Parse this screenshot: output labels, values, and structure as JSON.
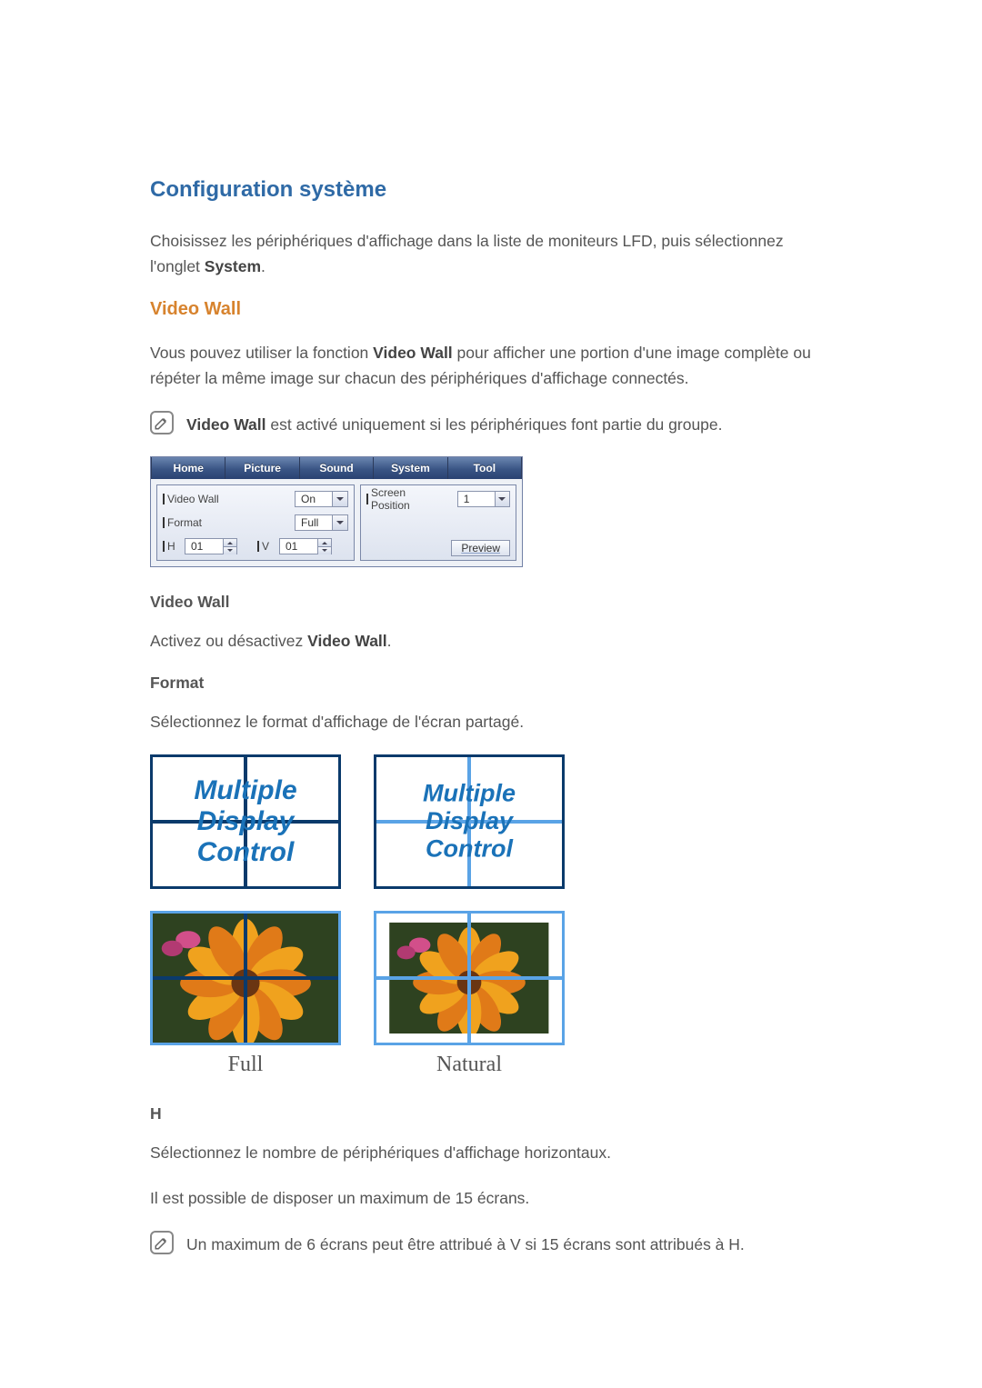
{
  "page": {
    "heading": "Configuration système",
    "intro_pre": "Choisissez les périphériques d'affichage dans la liste de moniteurs LFD, puis sélectionnez l'onglet ",
    "intro_bold": "System",
    "intro_post": "."
  },
  "videowall_section": {
    "title": "Video Wall",
    "desc_pre": "Vous pouvez utiliser la fonction ",
    "desc_bold": "Video Wall",
    "desc_post": " pour afficher une portion d'une image complète ou répéter la même image sur chacun des périphériques d'affichage connectés.",
    "note_bold": "Video Wall",
    "note_rest": " est activé uniquement si les périphériques font partie du groupe."
  },
  "panel": {
    "tabs": [
      "Home",
      "Picture",
      "Sound",
      "System",
      "Tool"
    ],
    "labels": {
      "video_wall": "Video Wall",
      "format": "Format",
      "h": "H",
      "v": "V",
      "screen_position": "Screen Position"
    },
    "values": {
      "video_wall": "On",
      "format": "Full",
      "h": "01",
      "v": "01",
      "screen_position": "1"
    },
    "preview_btn": "Preview"
  },
  "video_wall_field": {
    "title": "Video Wall",
    "desc_pre": "Activez ou désactivez ",
    "desc_bold": "Video Wall",
    "desc_post": "."
  },
  "format_field": {
    "title": "Format",
    "desc": "Sélectionnez le format d'affichage de l'écran partagé.",
    "text_tile_lines": [
      "Multiple",
      "Display",
      "Control"
    ],
    "labels": {
      "full": "Full",
      "natural": "Natural"
    }
  },
  "h_field": {
    "title": "H",
    "desc": "Sélectionnez le nombre de périphériques d'affichage horizontaux.",
    "max": "Il est possible de disposer un maximum de 15 écrans.",
    "note": "Un maximum de 6 écrans peut être attribué à V si 15 écrans sont attribués à H."
  }
}
